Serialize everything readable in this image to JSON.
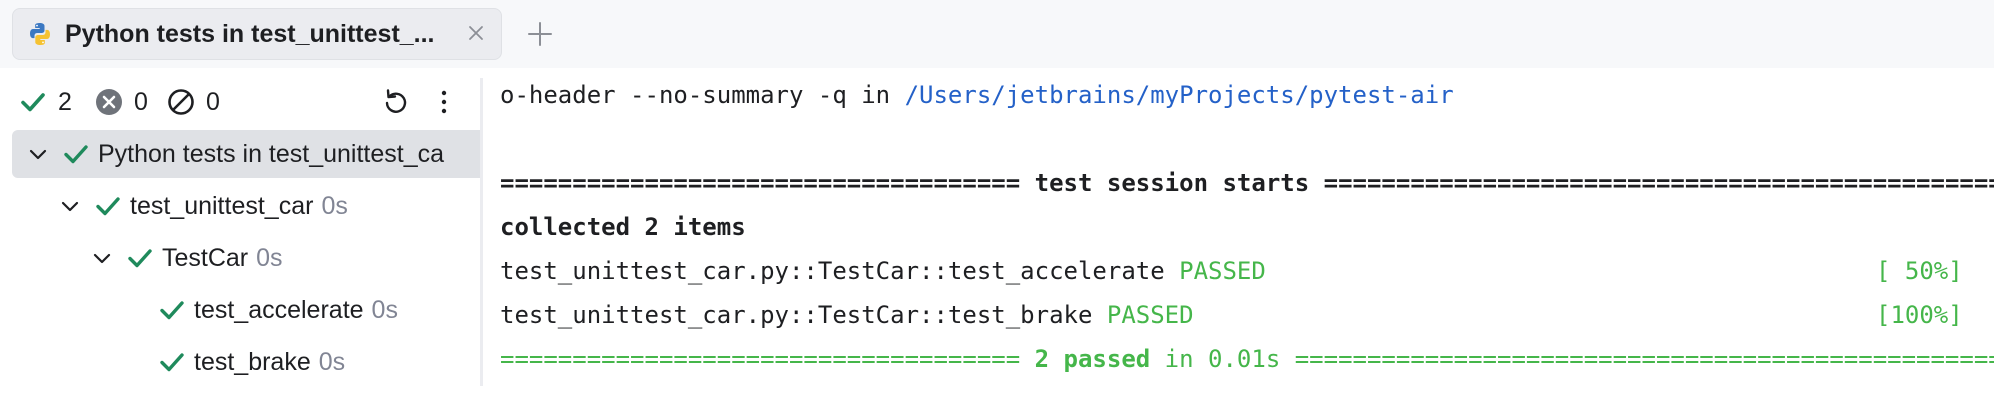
{
  "tab": {
    "title": "Python tests in test_unittest_...",
    "icon": "python-icon"
  },
  "counters": {
    "passed": "2",
    "failed": "0",
    "ignored": "0"
  },
  "tree": [
    {
      "label": "Python tests in test_unittest_ca",
      "duration": "",
      "expanded": true,
      "selected": true
    },
    {
      "label": "test_unittest_car",
      "duration": "0s",
      "expanded": true
    },
    {
      "label": "TestCar",
      "duration": "0s",
      "expanded": true
    },
    {
      "label": "test_accelerate",
      "duration": "0s"
    },
    {
      "label": "test_brake",
      "duration": "0s"
    }
  ],
  "console": {
    "cmd_prefix": "o-header --no-summary -q in ",
    "cmd_path": "/Users/jetbrains/myProjects/pytest-air",
    "session_left": "==================================== ",
    "session_mid": "test session starts",
    "session_right": " ==================================================",
    "collected": "collected 2 items",
    "test1_name": "test_unittest_car.py::TestCar::test_accelerate ",
    "test1_status": "PASSED",
    "test1_pct": "[ 50%]",
    "test2_name": "test_unittest_car.py::TestCar::test_brake ",
    "test2_status": "PASSED",
    "test2_pct": "[100%]",
    "summary_left": "==================================== ",
    "summary_bold": "2 passed",
    "summary_rest": " in 0.01s ",
    "summary_right": "=================================================="
  },
  "colors": {
    "success": "#45b64a",
    "check": "#1f8a5c",
    "link": "#2461c8"
  }
}
